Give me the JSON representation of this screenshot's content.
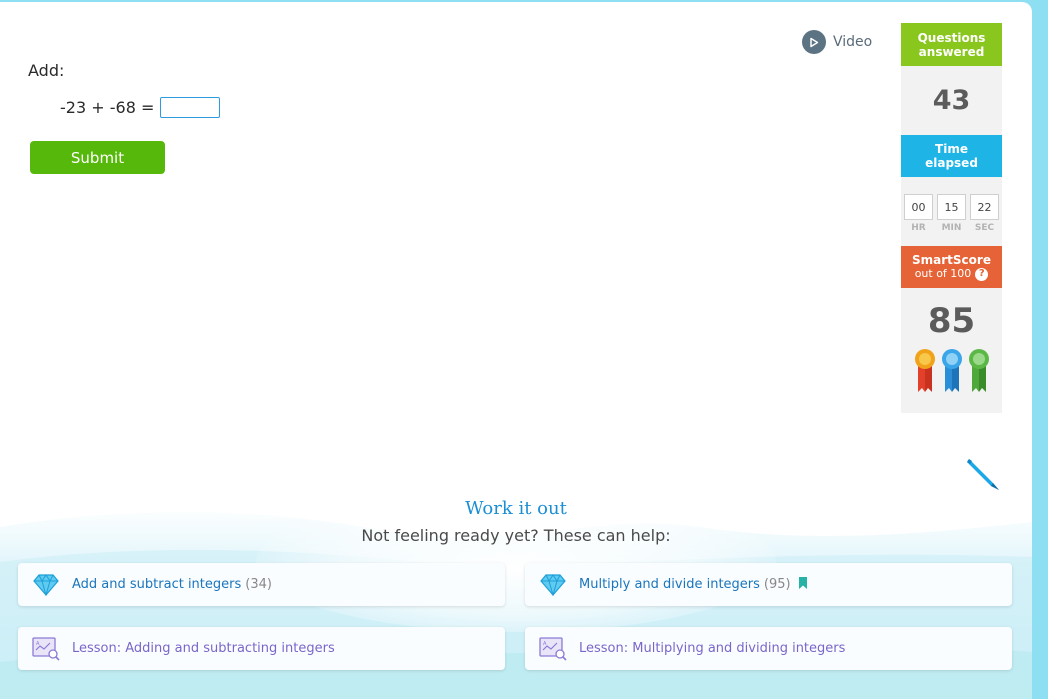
{
  "question": {
    "prompt": "Add:",
    "term1": "-23",
    "operator": "+",
    "term2": "-68",
    "equals": "=",
    "answer_value": "",
    "submit_label": "Submit"
  },
  "video": {
    "label": "Video"
  },
  "sidebar": {
    "questions_answered": {
      "label_line1": "Questions",
      "label_line2": "answered",
      "value": "43"
    },
    "time_elapsed": {
      "label_line1": "Time",
      "label_line2": "elapsed",
      "hours": "00",
      "minutes": "15",
      "seconds": "22",
      "hr_label": "HR",
      "min_label": "MIN",
      "sec_label": "SEC"
    },
    "smartscore": {
      "label": "SmartScore",
      "sublabel": "out of 100",
      "help": "?",
      "value": "85"
    },
    "ribbons": [
      "ribbon-orange-icon",
      "ribbon-blue-icon",
      "ribbon-green-icon"
    ]
  },
  "work_it_out": {
    "title": "Work it out",
    "subtitle": "Not feeling ready yet? These can help:"
  },
  "resources": [
    {
      "label": "Add and subtract integers",
      "count": "(34)",
      "icon": "diamond-icon"
    },
    {
      "label": "Multiply and divide integers",
      "count": "(95)",
      "icon": "diamond-icon",
      "bookmark": true
    },
    {
      "label": "Lesson: Adding and subtracting integers",
      "icon": "lesson-icon"
    },
    {
      "label": "Lesson: Multiplying and dividing integers",
      "icon": "lesson-icon"
    }
  ],
  "colors": {
    "submit": "#56b80a",
    "questions_header": "#8ac71e",
    "time_header": "#1fb4e6",
    "smartscore_header": "#e56336",
    "link": "#1a75bc",
    "lesson_link": "#7a66c9",
    "page_background": "#8fdff2"
  }
}
